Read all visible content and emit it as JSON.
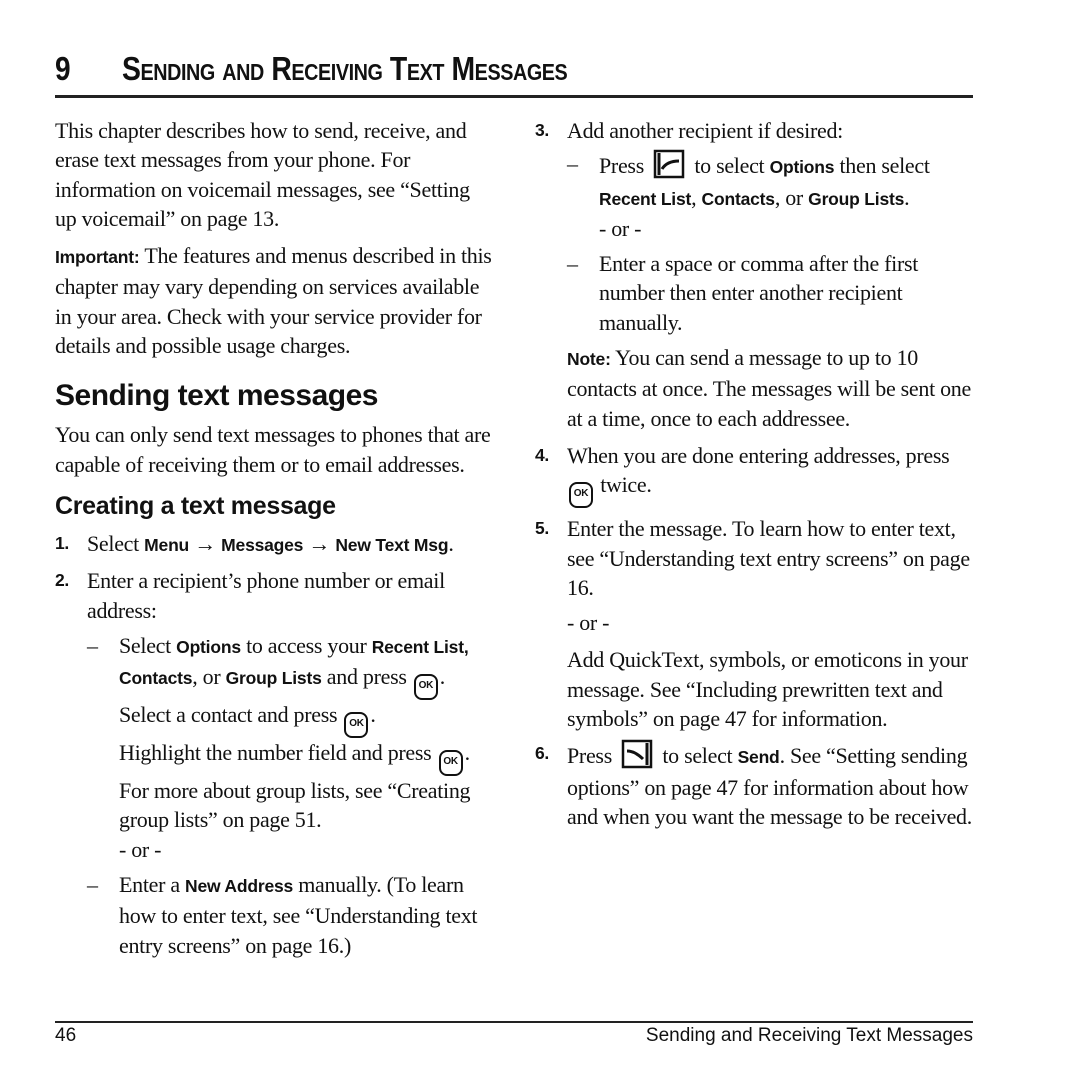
{
  "header": {
    "chapter_number": "9",
    "chapter_title": "Sending and Receiving Text Messages"
  },
  "left": {
    "intro": "This chapter describes how to send, receive, and erase text messages from your phone. For information on voicemail messages, see “Setting up voicemail” on page 13.",
    "important_label": "Important:",
    "important_text": "The features and menus described in this chapter may vary depending on services available in your area. Check with your service provider for details and possible usage charges.",
    "section_title": "Sending text messages",
    "section_intro": "You can only send text messages to phones that are capable of receiving them or to email addresses.",
    "subsection_title": "Creating a text message",
    "step1": {
      "num": "1.",
      "pre": "Select ",
      "menu": "Menu",
      "arrow1": " → ",
      "messages": "Messages",
      "arrow2": " → ",
      "new_text": "New Text Msg",
      "post": "."
    },
    "step2": {
      "num": "2.",
      "text": "Enter a recipient’s phone number or email address:",
      "dash1": {
        "dash": "–",
        "t1": "Select ",
        "options": "Options",
        "t2": " to access your ",
        "recent": "Recent List,",
        "contacts": "Contacts",
        "t3": ", or ",
        "group": "Group Lists",
        "t4": " and press ",
        "t5": ".",
        "t6": "Select a contact and press ",
        "t7": ".",
        "t8": "Highlight the number field and press ",
        "t9": ".",
        "t10": "For more about group lists, see “Creating group lists” on page 51.",
        "or": "- or -"
      },
      "dash2": {
        "dash": "–",
        "t1": "Enter a ",
        "new_address": "New Address",
        "t2": " manually. (To learn how to enter text, see “Understanding text entry screens” on page 16.)"
      }
    }
  },
  "right": {
    "step3": {
      "num": "3.",
      "text": "Add another recipient if desired:",
      "dash1": {
        "dash": "–",
        "t1": "Press ",
        "t2": " to select ",
        "options": "Options",
        "t3": " then select ",
        "recent": "Recent List",
        "c1": ", ",
        "contacts": "Contacts",
        "c2": ", or ",
        "group": "Group Lists",
        "c3": ".",
        "or": "- or -"
      },
      "dash2": {
        "dash": "–",
        "text": "Enter a space or comma after the first number then enter another recipient manually."
      }
    },
    "note_label": "Note:",
    "note_text": "You can send a message to up to 10 contacts at once. The messages will be sent one at a time, once to each addressee.",
    "step4": {
      "num": "4.",
      "t1": "When you are done entering addresses, press ",
      "t2": " twice."
    },
    "step5": {
      "num": "5.",
      "text": "Enter the message. To learn how to enter text, see “Understanding text entry screens” on page 16.",
      "or": "- or -",
      "alt": "Add QuickText, symbols, or emoticons in your message. See “Including prewritten text and symbols” on page 47 for information."
    },
    "step6": {
      "num": "6.",
      "t1": "Press ",
      "t2": " to select ",
      "send": "Send",
      "t3": ". See “Setting sending options” on page 47 for information about how and when you want the message to be received."
    }
  },
  "icons": {
    "ok_key": "OK",
    "left_soft_key": "left-soft-key-icon",
    "right_soft_key": "right-soft-key-icon"
  },
  "footer": {
    "page_number": "46",
    "running_title": "Sending and Receiving Text Messages"
  }
}
